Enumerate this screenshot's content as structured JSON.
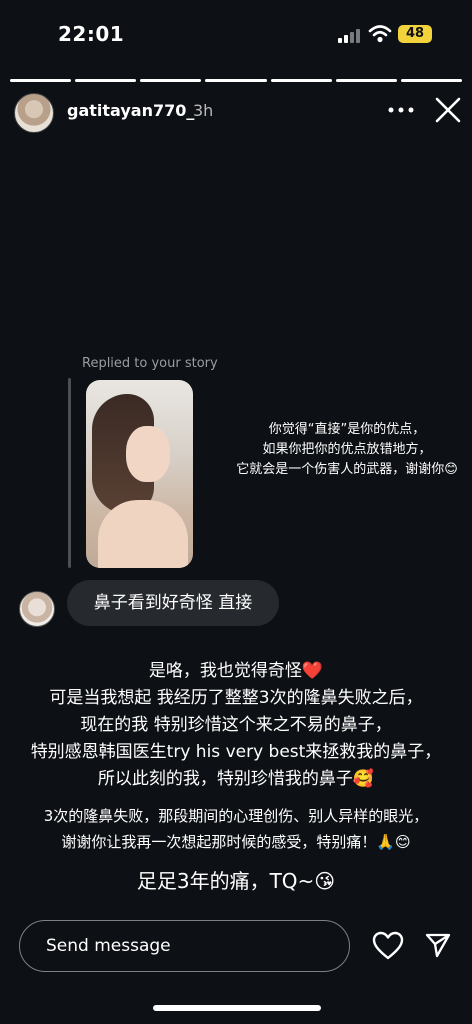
{
  "status_bar": {
    "time": "22:01",
    "battery": "48"
  },
  "story_progress": {
    "total_segments": 7,
    "completed_segments": 7
  },
  "header": {
    "username": "gatitayan770_",
    "age": "3h",
    "more_icon": "more-horizontal-icon",
    "close_icon": "close-icon"
  },
  "reply": {
    "label": "Replied to your story",
    "story_text_lines": [
      "你觉得“直接”是你的优点，",
      "如果你把你的优点放错地方，",
      "它就会是一个伤害人的武器，谢谢你😊"
    ]
  },
  "message": {
    "text": "鼻子看到好奇怪 直接"
  },
  "caption": {
    "block1": [
      "是咯，我也觉得奇怪❤️",
      "可是当我想起 我经历了整整3次的隆鼻失败之后，",
      "现在的我 特别珍惜这个来之不易的鼻子，",
      "特别感恩韩国医生try his very best来拯救我的鼻子，",
      "所以此刻的我，特别珍惜我的鼻子🥰"
    ],
    "block2": [
      "3次的隆鼻失败，那段期间的心理创伤、别人异样的眼光，",
      "谢谢你让我再一次想起那时候的感受，特别痛！🙏😊"
    ],
    "block3": "足足3年的痛，TQ~😘"
  },
  "composer": {
    "placeholder": "Send message",
    "like_icon": "heart-icon",
    "send_icon": "paper-plane-icon"
  },
  "colors": {
    "background": "#0d1014",
    "battery": "#f2d33c",
    "bubble": "#26292e"
  }
}
